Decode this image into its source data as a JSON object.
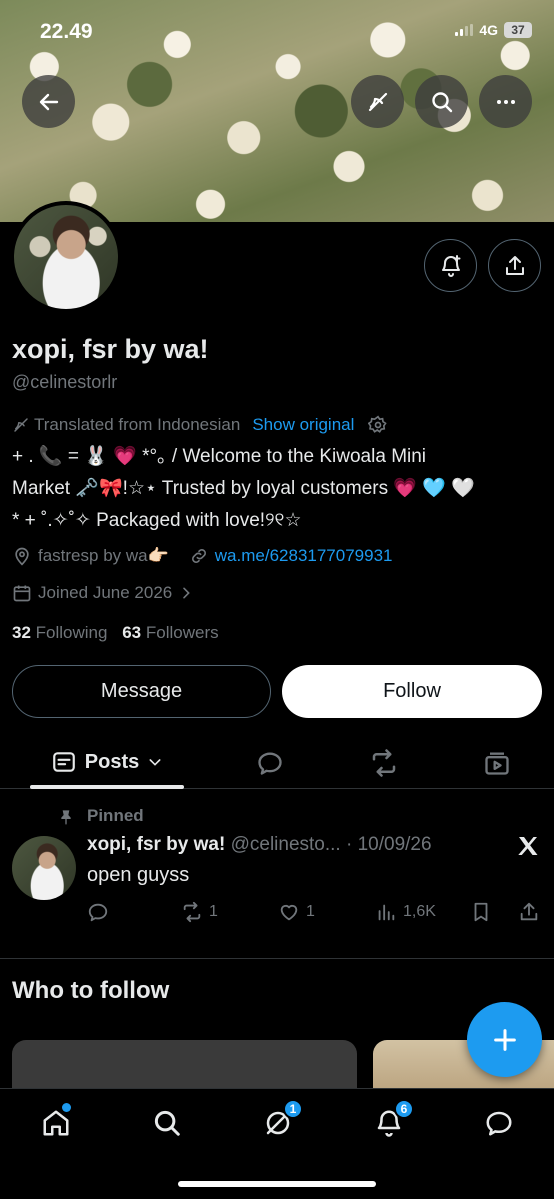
{
  "status_bar": {
    "time": "22.49",
    "network": "4G",
    "battery": "37"
  },
  "profile": {
    "name": "xopi, fsr by wa!",
    "handle": "@celinestorlr",
    "translated_label": "Translated from Indonesian",
    "show_original": "Show original",
    "bio_line1": "+ . 📞 = 🐰 💗 *°｡ / Welcome to the Kiwoala Mini",
    "bio_line2": "Market 🗝️🎀!☆⋆ Trusted by loyal customers 💗 🩵 🤍",
    "bio_line3": "* + ˚.✧˚✧ Packaged with love!୨୧☆",
    "location": "fastresp by wa👉🏻",
    "website": "wa.me/6283177079931",
    "joined": "Joined June 2026",
    "following_count": "32",
    "following_label": "Following",
    "followers_count": "63",
    "followers_label": "Followers"
  },
  "buttons": {
    "message": "Message",
    "follow": "Follow"
  },
  "tabs": {
    "posts": "Posts"
  },
  "pinned_post": {
    "pinned_label": "Pinned",
    "author": "xopi, fsr by wa!",
    "handle": "@celinesto...",
    "separator": "·",
    "date": "10/09/26",
    "text": "open guyss",
    "retweets": "1",
    "likes": "1",
    "views": "1,6K"
  },
  "who_to_follow": {
    "title": "Who to follow"
  },
  "nav": {
    "messages_badge": "1",
    "notifications_badge": "6"
  },
  "colors": {
    "accent": "#1d9bf0",
    "background": "#000000",
    "muted": "#71767b",
    "text": "#e7e9ea"
  },
  "icons": [
    "back-arrow-icon",
    "translate-off-icon",
    "search-icon",
    "more-icon",
    "bell-plus-icon",
    "share-icon",
    "location-icon",
    "link-icon",
    "calendar-icon",
    "pin-icon",
    "x-logo-icon"
  ]
}
